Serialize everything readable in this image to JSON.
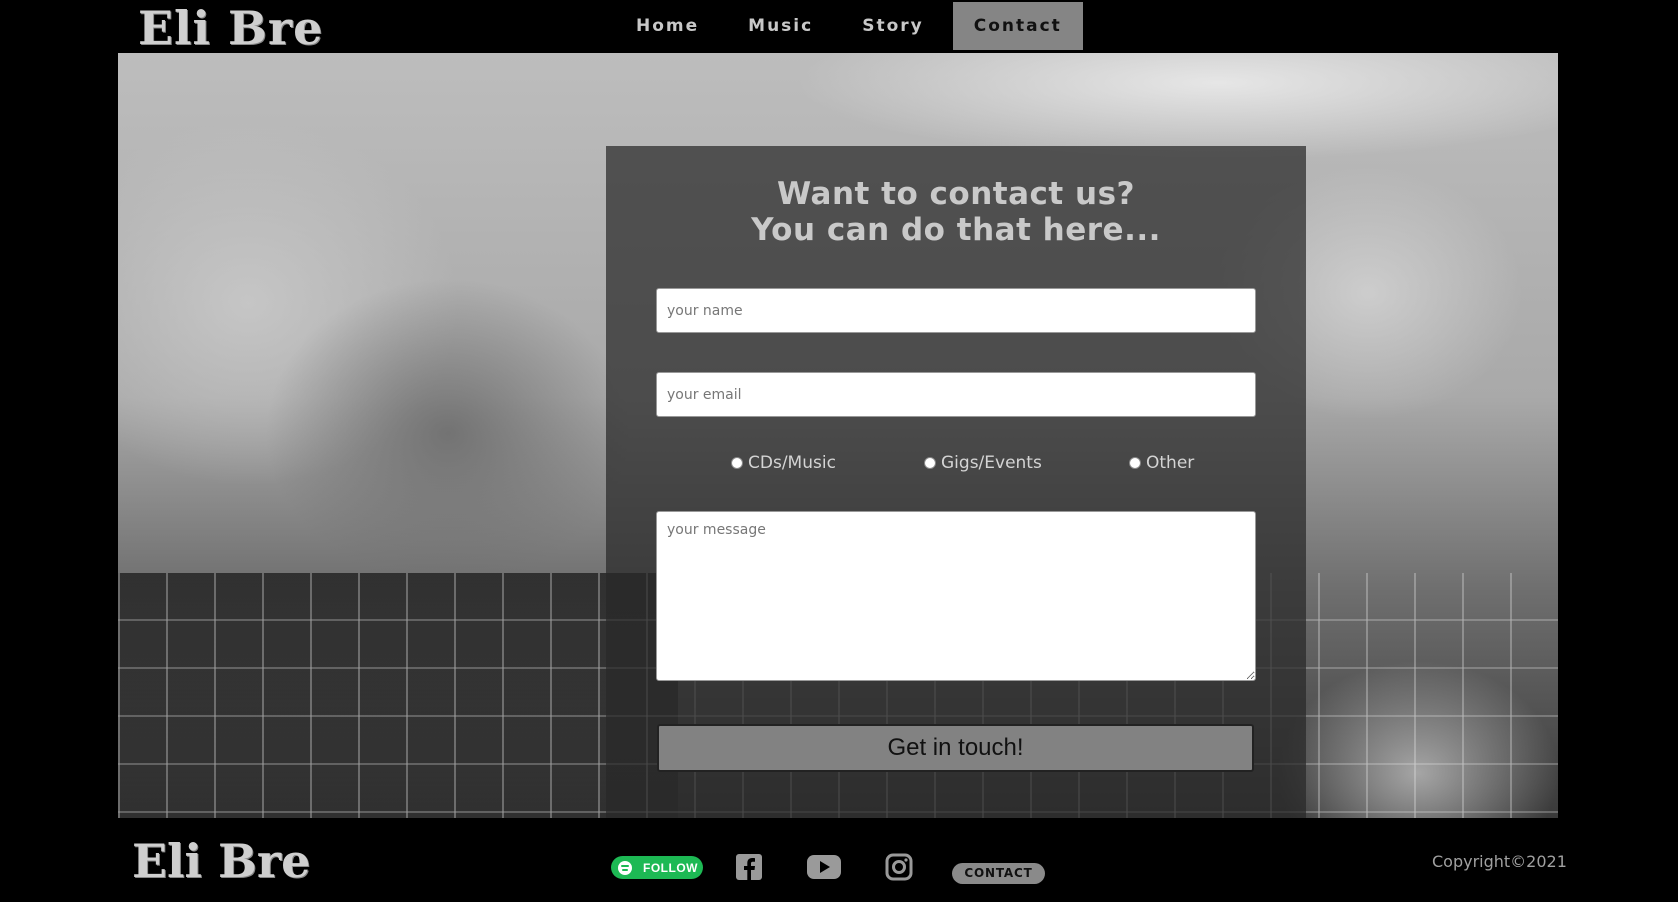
{
  "header": {
    "logo": "Eli Bre",
    "nav": [
      {
        "label": "Home"
      },
      {
        "label": "Music"
      },
      {
        "label": "Story"
      },
      {
        "label": "Contact",
        "active": true
      }
    ]
  },
  "form": {
    "title_line1": "Want to contact us?",
    "title_line2": "You can do that here...",
    "name_placeholder": "your name",
    "email_placeholder": "your email",
    "message_placeholder": "your message",
    "radio_options": [
      "CDs/Music",
      "Gigs/Events",
      "Other"
    ],
    "submit_label": "Get in touch!"
  },
  "footer": {
    "logo": "Eli Bre",
    "spotify_label": "FOLLOW",
    "icons": [
      "spotify-icon",
      "facebook-icon",
      "youtube-icon",
      "instagram-icon"
    ],
    "contact_label": "CONTACT",
    "copyright": "Copyright©2021"
  },
  "colors": {
    "background": "#000000",
    "nav_active": "#858585",
    "spotify_green": "#1db954",
    "panel": "#282828"
  }
}
